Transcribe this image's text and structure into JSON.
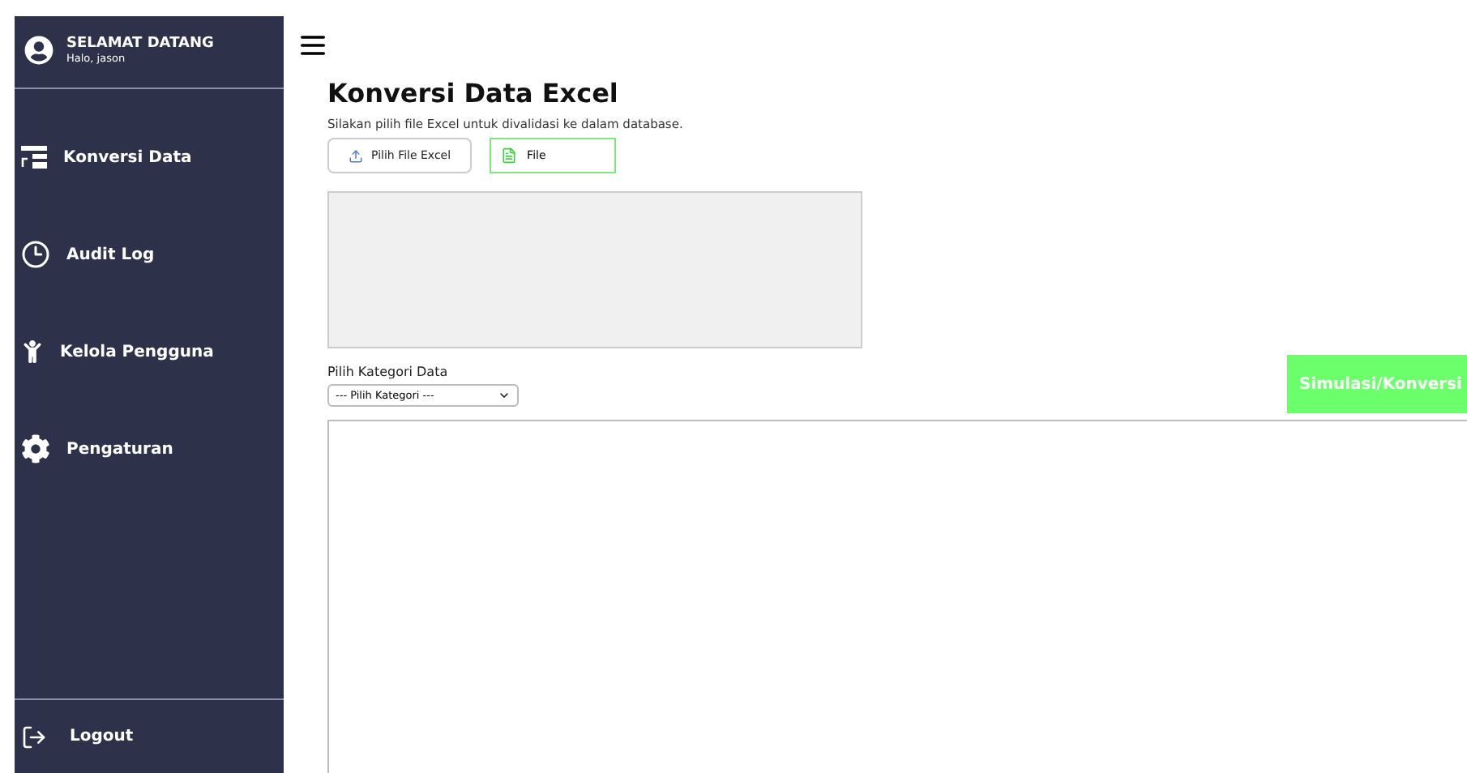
{
  "sidebar": {
    "greeting": "SELAMAT DATANG",
    "user": "Halo, jason",
    "items": [
      {
        "label": "Konversi Data"
      },
      {
        "label": "Audit Log"
      },
      {
        "label": "Kelola Pengguna"
      },
      {
        "label": "Pengaturan"
      }
    ],
    "logout": "Logout"
  },
  "main": {
    "title": "Konversi Data Excel",
    "subtitle": "Silakan pilih file Excel untuk divalidasi ke dalam database.",
    "pick_button": "Pilih File Excel",
    "file_label": "File",
    "category_label": "Pilih Kategori Data",
    "category_select": "--- Pilih Kategori ---",
    "action_button": "Simulasi/Konversi"
  }
}
